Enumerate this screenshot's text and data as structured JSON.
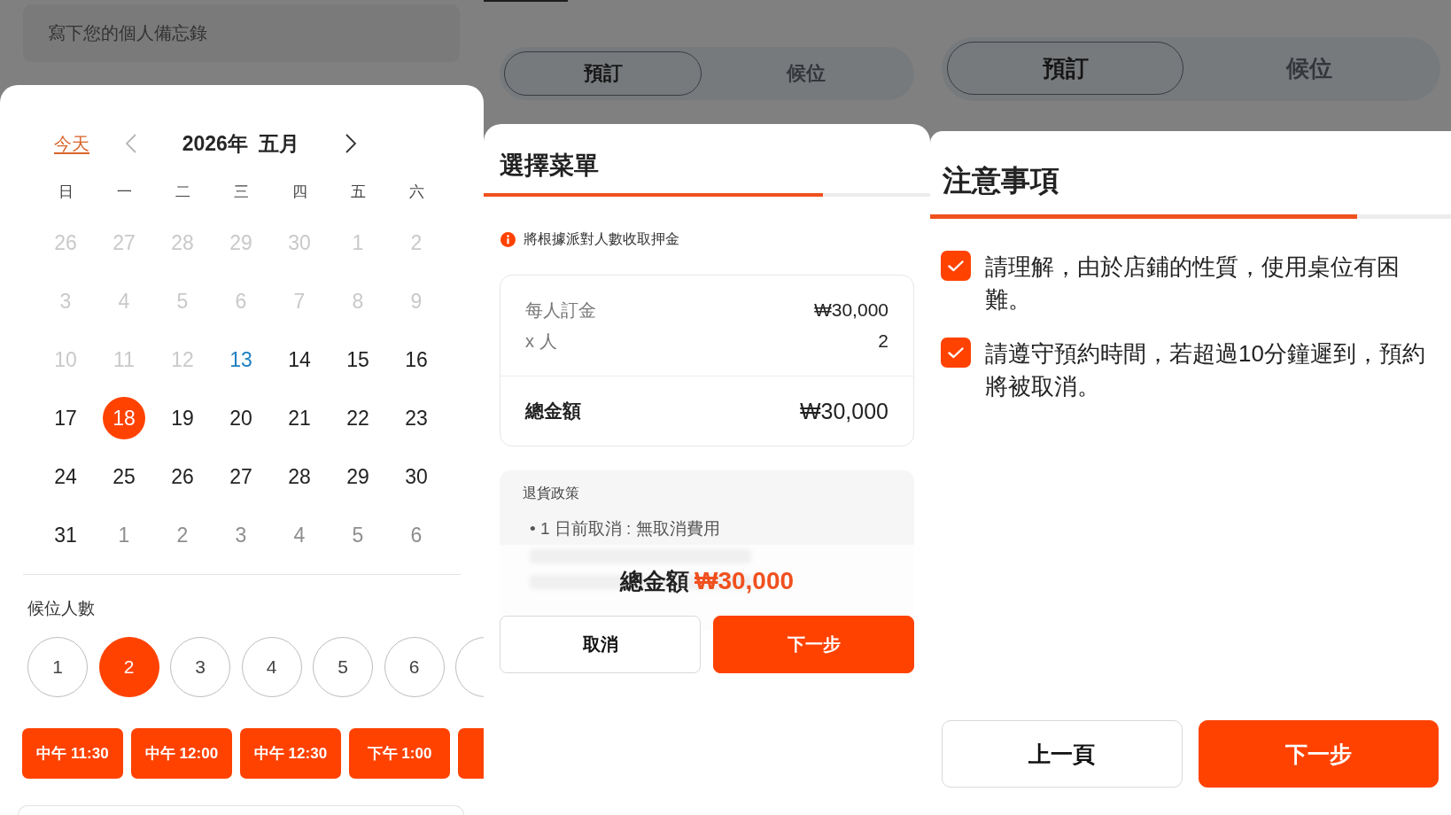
{
  "calendar_screen": {
    "memo_field": {
      "placeholder": "寫下您的個人備忘錄"
    },
    "today_link": "今天",
    "prev_month": {
      "disabled": true
    },
    "month_title": "2026年 五月",
    "next_month": {
      "disabled": false
    },
    "weekdays": [
      "日",
      "一",
      "二",
      "三",
      "四",
      "五",
      "六"
    ],
    "weeks": [
      [
        {
          "label": "26",
          "kind": "past",
          "selected": false
        },
        {
          "label": "27",
          "kind": "past",
          "selected": false
        },
        {
          "label": "28",
          "kind": "past",
          "selected": false
        },
        {
          "label": "29",
          "kind": "past",
          "selected": false
        },
        {
          "label": "30",
          "kind": "past",
          "selected": false
        },
        {
          "label": "1",
          "kind": "past",
          "selected": false
        },
        {
          "label": "2",
          "kind": "past",
          "selected": false
        }
      ],
      [
        {
          "label": "3",
          "kind": "past",
          "selected": false
        },
        {
          "label": "4",
          "kind": "past",
          "selected": false
        },
        {
          "label": "5",
          "kind": "past",
          "selected": false
        },
        {
          "label": "6",
          "kind": "past",
          "selected": false
        },
        {
          "label": "7",
          "kind": "past",
          "selected": false
        },
        {
          "label": "8",
          "kind": "past",
          "selected": false
        },
        {
          "label": "9",
          "kind": "past",
          "selected": false
        }
      ],
      [
        {
          "label": "10",
          "kind": "past",
          "selected": false
        },
        {
          "label": "11",
          "kind": "past",
          "selected": false
        },
        {
          "label": "12",
          "kind": "past",
          "selected": false
        },
        {
          "label": "13",
          "kind": "today",
          "selected": false
        },
        {
          "label": "14",
          "kind": "open",
          "selected": false
        },
        {
          "label": "15",
          "kind": "open",
          "selected": false
        },
        {
          "label": "16",
          "kind": "open",
          "selected": false
        }
      ],
      [
        {
          "label": "17",
          "kind": "open",
          "selected": false
        },
        {
          "label": "18",
          "kind": "open",
          "selected": true
        },
        {
          "label": "19",
          "kind": "open",
          "selected": false
        },
        {
          "label": "20",
          "kind": "open",
          "selected": false
        },
        {
          "label": "21",
          "kind": "open",
          "selected": false
        },
        {
          "label": "22",
          "kind": "open",
          "selected": false
        },
        {
          "label": "23",
          "kind": "open",
          "selected": false
        }
      ],
      [
        {
          "label": "24",
          "kind": "open",
          "selected": false
        },
        {
          "label": "25",
          "kind": "open",
          "selected": false
        },
        {
          "label": "26",
          "kind": "open",
          "selected": false
        },
        {
          "label": "27",
          "kind": "open",
          "selected": false
        },
        {
          "label": "28",
          "kind": "open",
          "selected": false
        },
        {
          "label": "29",
          "kind": "open",
          "selected": false
        },
        {
          "label": "30",
          "kind": "open",
          "selected": false
        }
      ],
      [
        {
          "label": "31",
          "kind": "open",
          "selected": false
        },
        {
          "label": "1",
          "kind": "next_month",
          "selected": false
        },
        {
          "label": "2",
          "kind": "next_month",
          "selected": false
        },
        {
          "label": "3",
          "kind": "next_month",
          "selected": false
        },
        {
          "label": "4",
          "kind": "next_month",
          "selected": false
        },
        {
          "label": "5",
          "kind": "next_month",
          "selected": false
        },
        {
          "label": "6",
          "kind": "next_month",
          "selected": false
        }
      ]
    ],
    "party_size": {
      "label": "候位人數",
      "options": [
        {
          "label": "1",
          "selected": false,
          "cut": false
        },
        {
          "label": "2",
          "selected": true,
          "cut": false
        },
        {
          "label": "3",
          "selected": false,
          "cut": false
        },
        {
          "label": "4",
          "selected": false,
          "cut": false
        },
        {
          "label": "5",
          "selected": false,
          "cut": false
        },
        {
          "label": "6",
          "selected": false,
          "cut": false
        },
        {
          "selected": false,
          "cut": true
        }
      ]
    },
    "time_slots": [
      {
        "label": "中午 11:30",
        "cut": false
      },
      {
        "label": "中午 12:00",
        "cut": false
      },
      {
        "label": "中午 12:30",
        "cut": false
      },
      {
        "label": "下午 1:00",
        "cut": false
      },
      {
        "cut": true
      }
    ]
  },
  "menu_screen": {
    "tabs": [
      {
        "label": "預訂",
        "selected": true
      },
      {
        "label": "候位",
        "selected": false
      }
    ],
    "title": "選擇菜單",
    "progress": {
      "level": 0.76
    },
    "notice": "將根據派對人數收取押金",
    "price_rows": [
      {
        "label": "每人訂金",
        "value": "₩30,000"
      },
      {
        "label": "x 人",
        "value": "2"
      }
    ],
    "total": {
      "label": "總金額",
      "value": "₩30,000"
    },
    "policy": {
      "title": "退貨政策",
      "items": [
        {
          "text": "• 1 日前取消 : 無取消費用",
          "blurred": false
        },
        {
          "blurred": true
        },
        {
          "blurred": true
        }
      ]
    },
    "summary": {
      "label": "總金額",
      "value": "₩30,000"
    },
    "buttons": [
      {
        "label": "取消",
        "kind": "cancel"
      },
      {
        "label": "下一步",
        "kind": "next"
      }
    ]
  },
  "notice_screen": {
    "tabs": [
      {
        "label": "預訂",
        "selected": true
      },
      {
        "label": "候位",
        "selected": false
      }
    ],
    "title": "注意事項",
    "progress": {
      "level": 0.82
    },
    "items": [
      {
        "text": "請理解，由於店鋪的性質，使用桌位有困難。",
        "checked": true
      },
      {
        "text": "請遵守預約時間，若超過10分鐘遲到，預約將被取消。",
        "checked": true
      }
    ],
    "buttons": [
      {
        "label": "上一頁",
        "kind": "back"
      },
      {
        "label": "下一步",
        "kind": "next"
      }
    ]
  }
}
